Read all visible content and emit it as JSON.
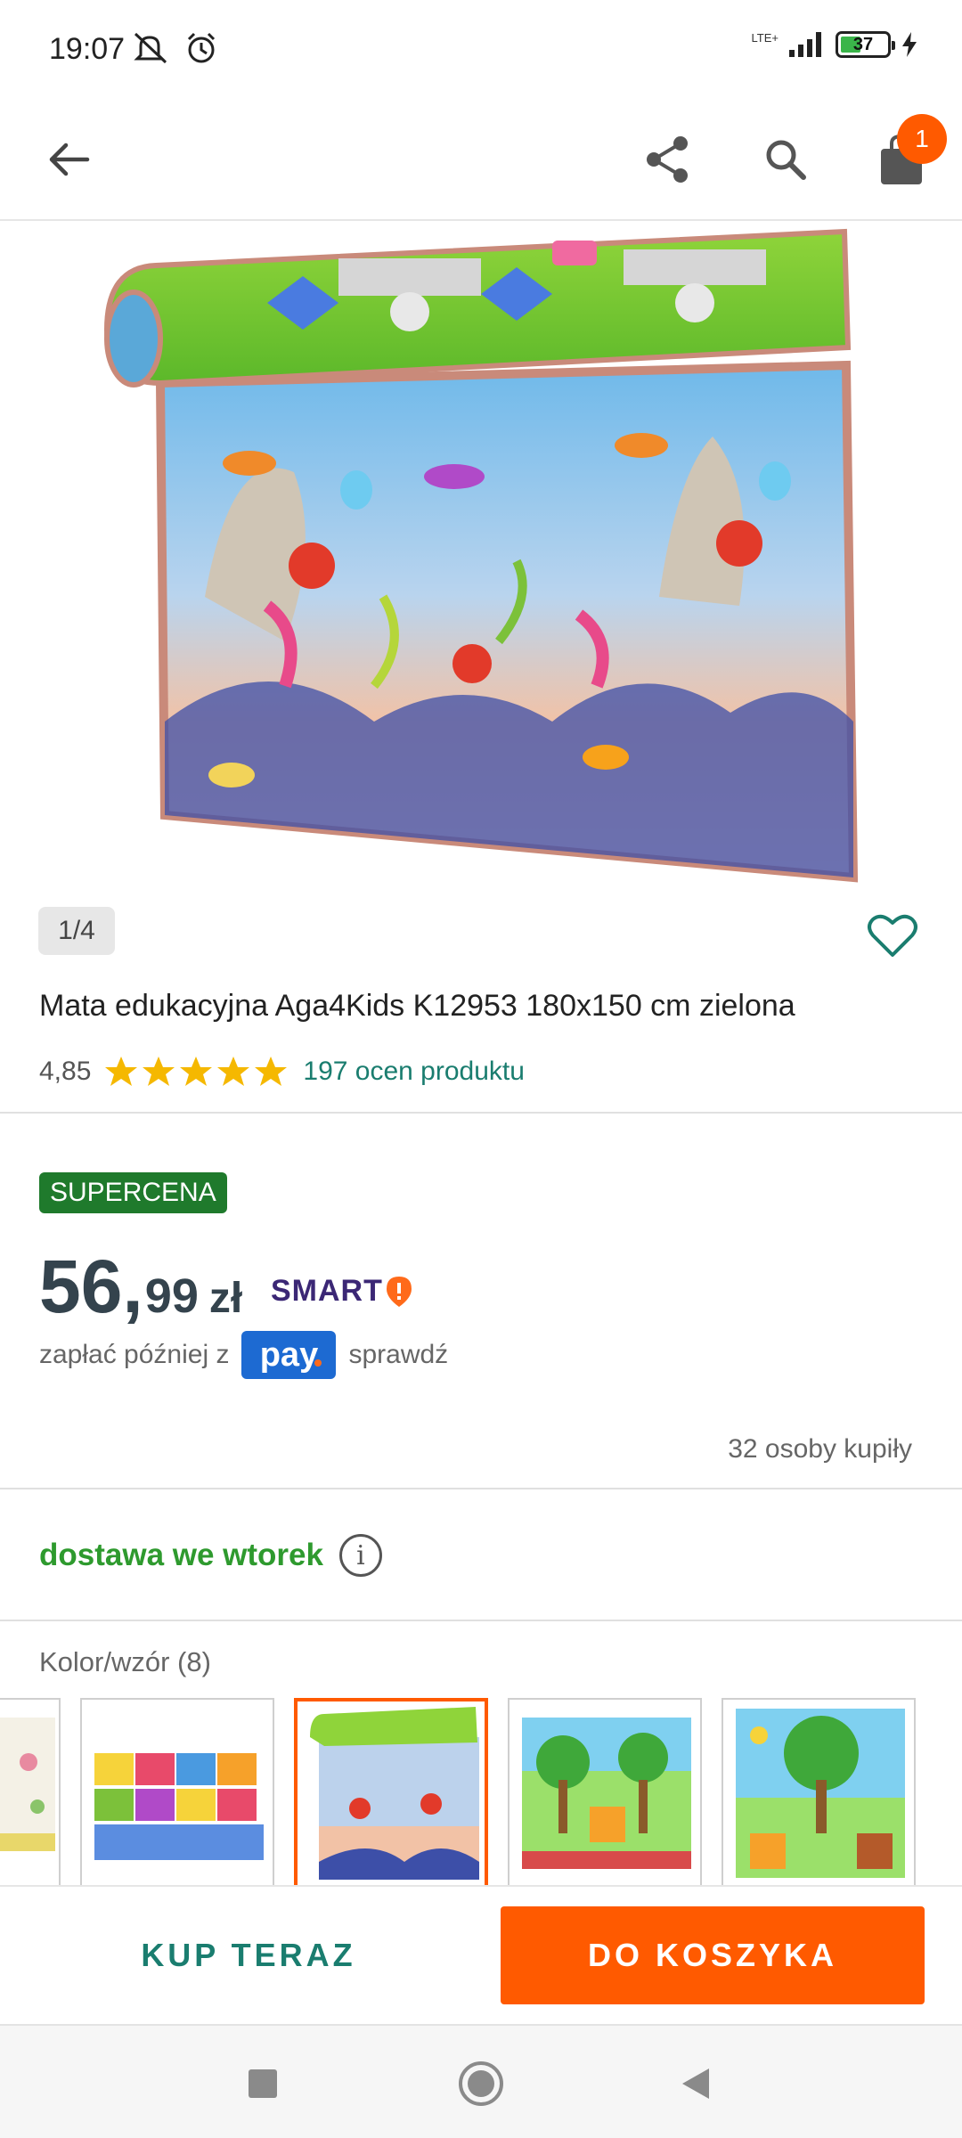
{
  "status_bar": {
    "time": "19:07",
    "network": "LTE+",
    "battery": "37"
  },
  "app_bar": {
    "cart_count": "1"
  },
  "gallery": {
    "counter": "1/4"
  },
  "product": {
    "title": "Mata edukacyjna Aga4Kids K12953 180x150 cm zielona",
    "rating": "4,85",
    "stars": 5,
    "reviews": "197 ocen produktu"
  },
  "pricing": {
    "badge": "SUPERCENA",
    "price_main": "56,",
    "price_cents": "99",
    "currency": "zł",
    "smart_label": "SMART",
    "pay_prefix": "zapłać później z",
    "pay_logo": "pay",
    "pay_suffix": "sprawdź",
    "bought": "32 osoby kupiły"
  },
  "delivery": {
    "label": "dostawa we wtorek",
    "info": "i"
  },
  "variants": {
    "label": "Kolor/wzór (8)",
    "count": 5,
    "selected_index": 2
  },
  "actions": {
    "buy_now": "KUP TERAZ",
    "add_to_cart": "DO KOSZYKA"
  },
  "colors": {
    "accent": "#ff5a00",
    "teal": "#1a7d6f",
    "green": "#2e9a2e",
    "badge_green": "#1f7a2c",
    "star": "#f5b800"
  }
}
